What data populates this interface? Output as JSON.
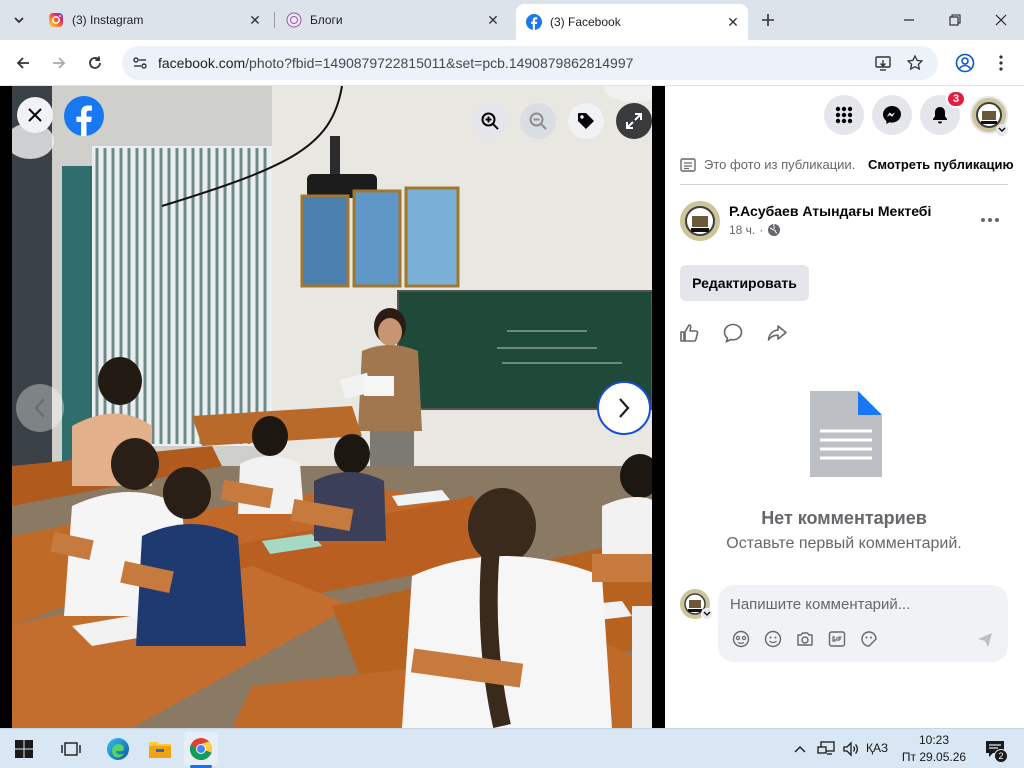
{
  "browser": {
    "tabs": [
      {
        "title": "(3) Instagram",
        "favicon": "instagram-icon"
      },
      {
        "title": "Блоги",
        "favicon": "blog-icon"
      },
      {
        "title": "(3) Facebook",
        "favicon": "facebook-icon",
        "active": true
      }
    ],
    "url_host": "facebook.com",
    "url_path": "/photo?fbid=1490879722815011&set=pcb.1490879862814997"
  },
  "topbar": {
    "notification_count": "3"
  },
  "post": {
    "notice": "Это фото из публикации.",
    "view_post_label": "Смотреть публикацию",
    "author": "Р.Асубаев Атындағы Мектебі",
    "time": "18 ч.",
    "time_separator": "·",
    "edit_label": "Редактировать"
  },
  "comments": {
    "empty_title": "Нет комментариев",
    "empty_subtitle": "Оставьте первый комментарий.",
    "placeholder": "Напишите комментарий..."
  },
  "taskbar": {
    "language": "ҚАЗ",
    "time": "10:23",
    "date": "Пт 29.05.26",
    "notification_count": "2"
  },
  "colors": {
    "facebook_blue": "#1877f2",
    "badge_red": "#e41e3f",
    "chalkboard_green": "#1f4a3a"
  }
}
